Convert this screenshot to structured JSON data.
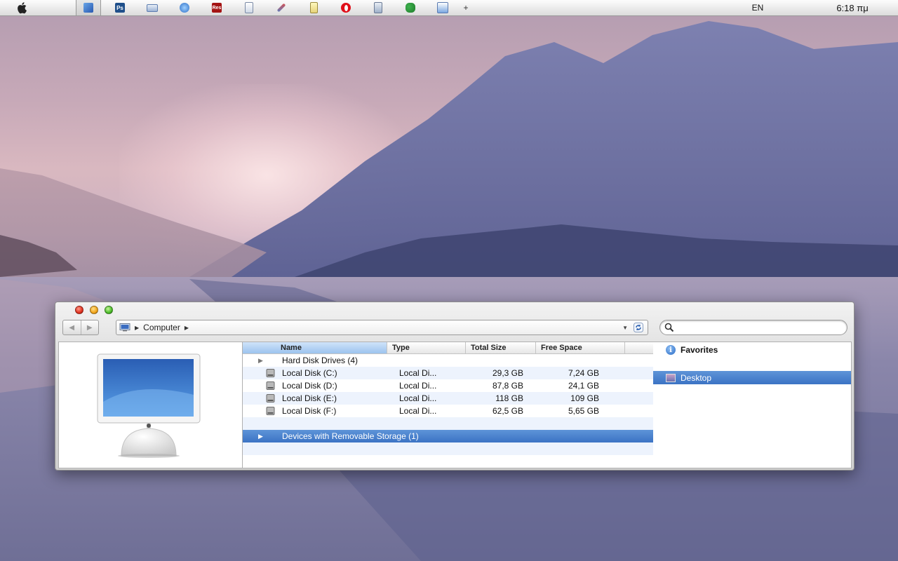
{
  "menubar": {
    "quicklaunch": [
      {
        "name": "finder-icon",
        "label": ""
      },
      {
        "name": "photoshop-icon",
        "label": "Ps"
      },
      {
        "name": "keyboard-icon",
        "label": ""
      },
      {
        "name": "internet-explorer-icon",
        "label": ""
      },
      {
        "name": "resource-hacker-icon",
        "label": "Res"
      },
      {
        "name": "notepad-icon",
        "label": ""
      },
      {
        "name": "tools-icon",
        "label": ""
      },
      {
        "name": "notes-icon",
        "label": ""
      },
      {
        "name": "opera-icon",
        "label": ""
      },
      {
        "name": "calculator-icon",
        "label": ""
      },
      {
        "name": "users-icon",
        "label": ""
      },
      {
        "name": "picture-icon",
        "label": ""
      }
    ],
    "add_label": "+",
    "language": "EN",
    "clock": "6:18 πμ"
  },
  "window": {
    "address": {
      "breadcrumb": "Computer"
    },
    "search": {
      "placeholder": ""
    },
    "columns": {
      "name": "Name",
      "type": "Type",
      "total_size": "Total Size",
      "free_space": "Free Space"
    },
    "groups": {
      "hard_disks": "Hard Disk Drives (4)",
      "removable": "Devices with Removable Storage (1)"
    },
    "drives": [
      {
        "name": "Local Disk (C:)",
        "type": "Local Di...",
        "total": "29,3 GB",
        "free": "7,24 GB"
      },
      {
        "name": "Local Disk (D:)",
        "type": "Local Di...",
        "total": "87,8 GB",
        "free": "24,1 GB"
      },
      {
        "name": "Local Disk (E:)",
        "type": "Local Di...",
        "total": "118 GB",
        "free": "109 GB"
      },
      {
        "name": "Local Disk (F:)",
        "type": "Local Di...",
        "total": "62,5 GB",
        "free": "5,65 GB"
      }
    ],
    "sidebar": {
      "favorites": "Favorites",
      "desktop": "Desktop"
    }
  }
}
